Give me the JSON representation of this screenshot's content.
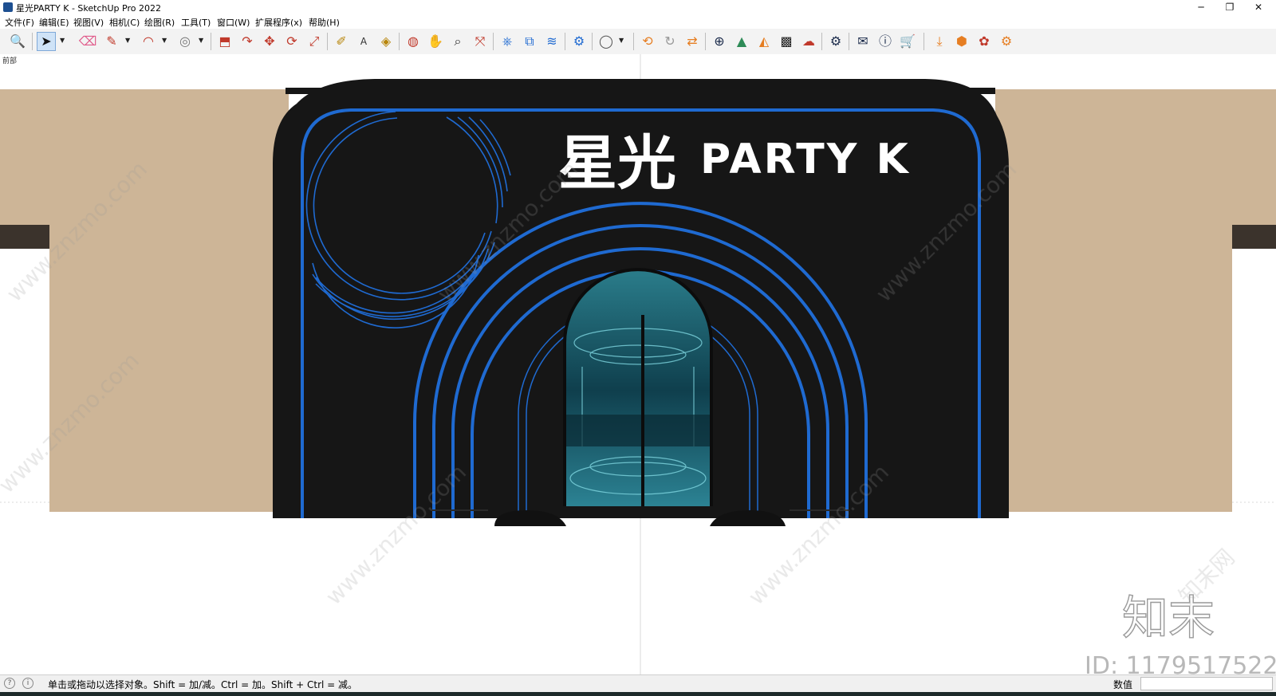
{
  "window": {
    "title": "星光PARTY K - SketchUp Pro 2022",
    "controls": [
      "─",
      "❐",
      "✕"
    ]
  },
  "menu": [
    "文件(F)",
    "编辑(E)",
    "视图(V)",
    "相机(C)",
    "绘图(R)",
    "工具(T)",
    "窗口(W)",
    "扩展程序(x)",
    "帮助(H)"
  ],
  "toolbar": {
    "icons": [
      {
        "name": "zoom-icon",
        "glyph": "🔍"
      },
      {
        "name": "select-arrow-icon",
        "glyph": "➤"
      },
      {
        "name": "eraser-icon",
        "glyph": "⌫"
      },
      {
        "name": "pencil-icon",
        "glyph": "✎"
      },
      {
        "name": "arc-icon",
        "glyph": "◠"
      },
      {
        "name": "circle-shape-icon",
        "glyph": "◎"
      },
      {
        "name": "push-pull-icon",
        "glyph": "⬒"
      },
      {
        "name": "follow-me-icon",
        "glyph": "↷"
      },
      {
        "name": "move-icon",
        "glyph": "✥"
      },
      {
        "name": "rotate-icon",
        "glyph": "⟳"
      },
      {
        "name": "scale-icon",
        "glyph": "⤢"
      },
      {
        "name": "tape-measure-icon",
        "glyph": "✐"
      },
      {
        "name": "text-label-icon",
        "glyph": "A"
      },
      {
        "name": "paint-bucket-icon",
        "glyph": "◈"
      },
      {
        "name": "orbit-icon",
        "glyph": "◍"
      },
      {
        "name": "pan-hand-icon",
        "glyph": "✋"
      },
      {
        "name": "zoom-tool-icon",
        "glyph": "⌕"
      },
      {
        "name": "zoom-extents-icon",
        "glyph": "⤧"
      },
      {
        "name": "warehouse-icon",
        "glyph": "⎈"
      },
      {
        "name": "components-icon",
        "glyph": "⧉"
      },
      {
        "name": "layers-icon",
        "glyph": "≋"
      },
      {
        "name": "styles-icon",
        "glyph": "⚙"
      },
      {
        "name": "account-icon",
        "glyph": "◯"
      },
      {
        "name": "export-icon",
        "glyph": "⟲"
      },
      {
        "name": "refresh-icon",
        "glyph": "↻"
      },
      {
        "name": "swap-icon",
        "glyph": "⇄"
      },
      {
        "name": "add-icon",
        "glyph": "⊕"
      },
      {
        "name": "tree-icon",
        "glyph": "▲"
      },
      {
        "name": "terrain-icon",
        "glyph": "◭"
      },
      {
        "name": "checker-icon",
        "glyph": "▩"
      },
      {
        "name": "cloud-upload-icon",
        "glyph": "☁"
      },
      {
        "name": "settings-gears-icon",
        "glyph": "⚙"
      },
      {
        "name": "mail-icon",
        "glyph": "✉"
      },
      {
        "name": "info-icon",
        "glyph": "ⓘ"
      },
      {
        "name": "cart-icon",
        "glyph": "🛒"
      },
      {
        "name": "import-icon",
        "glyph": "⤓"
      },
      {
        "name": "plugin-orange-icon",
        "glyph": "⬢"
      },
      {
        "name": "plugin-red-icon",
        "glyph": "✿"
      },
      {
        "name": "plugin-gear-icon",
        "glyph": "⚙"
      }
    ]
  },
  "scene": {
    "tab_label": "前部",
    "sign_chinese": "星光",
    "sign_english": "PARTY K",
    "watermarks": [
      "www.znzmo.com",
      "知末网"
    ],
    "logo_text": "知末",
    "id_text": "ID: 1179517522",
    "colors": {
      "wall": "#cdb597",
      "facade": "#161616",
      "neon": "#1f6ad1",
      "trim": "#3b332c",
      "glass": "#1a5a6a"
    }
  },
  "status": {
    "hint": "单击或拖动以选择对象。Shift = 加/减。Ctrl = 加。Shift + Ctrl = 减。",
    "value_label": "数值",
    "value": ""
  }
}
